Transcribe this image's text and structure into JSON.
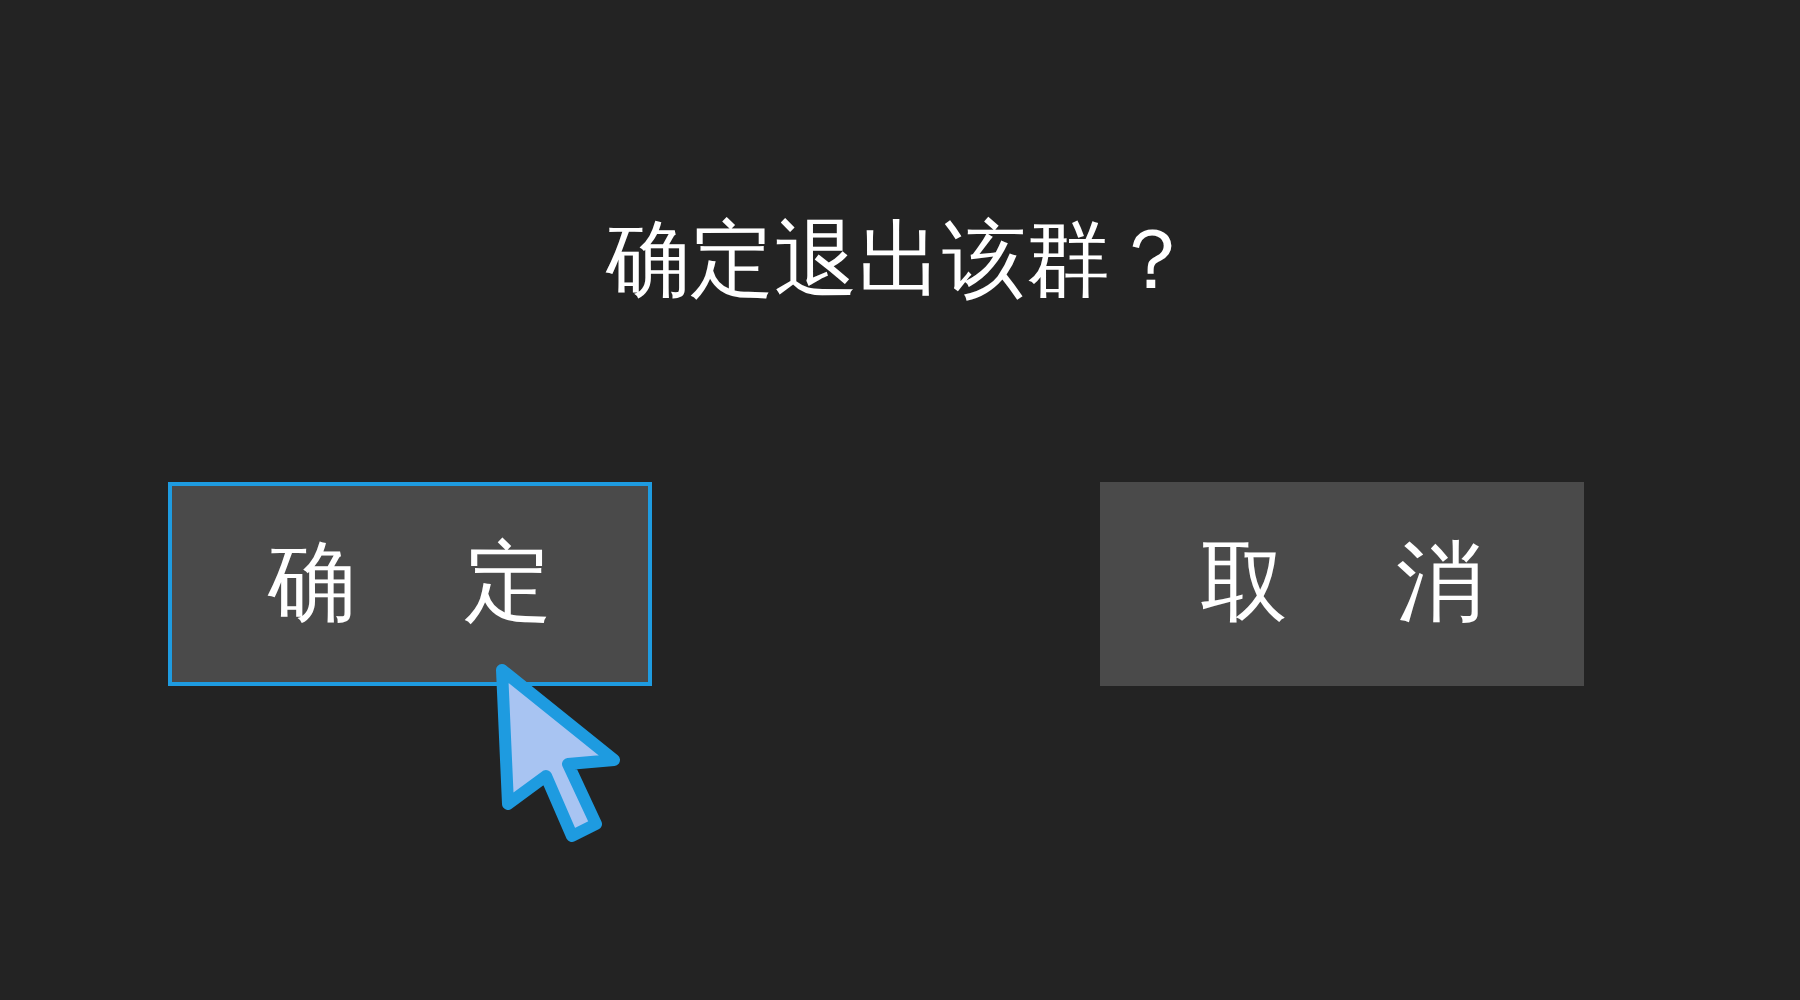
{
  "dialog": {
    "title": "确定退出该群？"
  },
  "buttons": [
    {
      "label": "确 定",
      "selected": true
    },
    {
      "label": "取 消",
      "selected": false
    }
  ]
}
